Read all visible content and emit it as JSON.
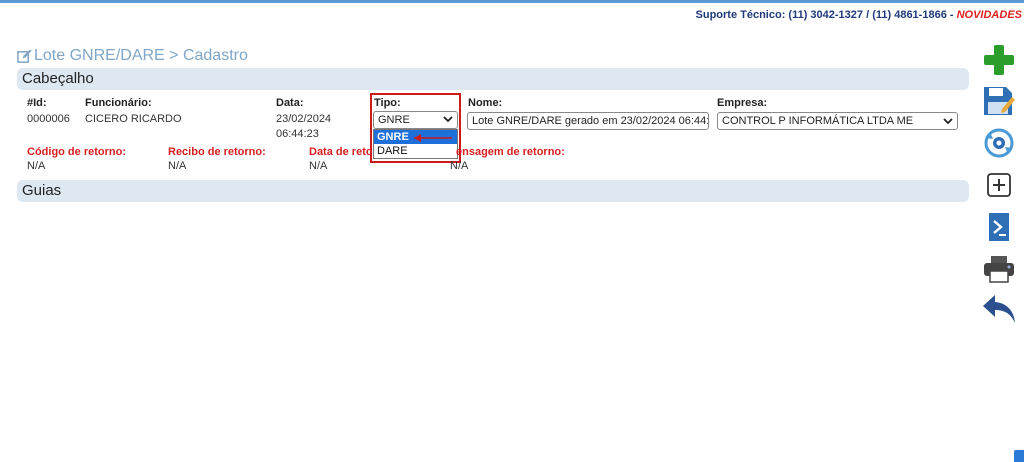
{
  "support": {
    "text": "Suporte Técnico: (11) 3042-1327 / (11) 4861-1866 - ",
    "news": "NOVIDADES"
  },
  "page": {
    "title": "Lote GNRE/DARE > Cadastro"
  },
  "sections": {
    "header": "Cabeçalho",
    "guias": "Guias"
  },
  "fields": {
    "id_label": "#Id:",
    "id_value": "0000006",
    "employee_label": "Funcionário:",
    "employee_value": "CICERO RICARDO",
    "date_label": "Data:",
    "date_value_1": "23/02/2024",
    "date_value_2": "06:44:23",
    "tipo_label": "Tipo:",
    "tipo_value": "GNRE",
    "tipo_options": [
      "GNRE",
      "DARE"
    ],
    "nome_label": "Nome:",
    "nome_value": "Lote GNRE/DARE gerado em 23/02/2024 06:44:",
    "empresa_label": "Empresa:",
    "empresa_value": "CONTROL P INFORMÁTICA LTDA ME",
    "codigo_label": "Código de retorno:",
    "codigo_value": "N/A",
    "recibo_label": "Recibo de retorno:",
    "recibo_value": "N/A",
    "data_ret_label": "Data de reto",
    "data_ret_value": "N/A",
    "msg_label": "ensagem de retorno:",
    "msg_value": "N/A"
  },
  "colors": {
    "accent": "#1e6fd9",
    "section_bg": "#dde8f3",
    "title": "#7fa6c8",
    "highlight": "#cc1b1b",
    "add_green": "#2a9d2a"
  },
  "toolbar": {
    "icons": [
      "add-icon",
      "save-icon",
      "sync-settings-icon",
      "add-square-icon",
      "powershell-icon",
      "print-icon",
      "back-icon"
    ]
  }
}
